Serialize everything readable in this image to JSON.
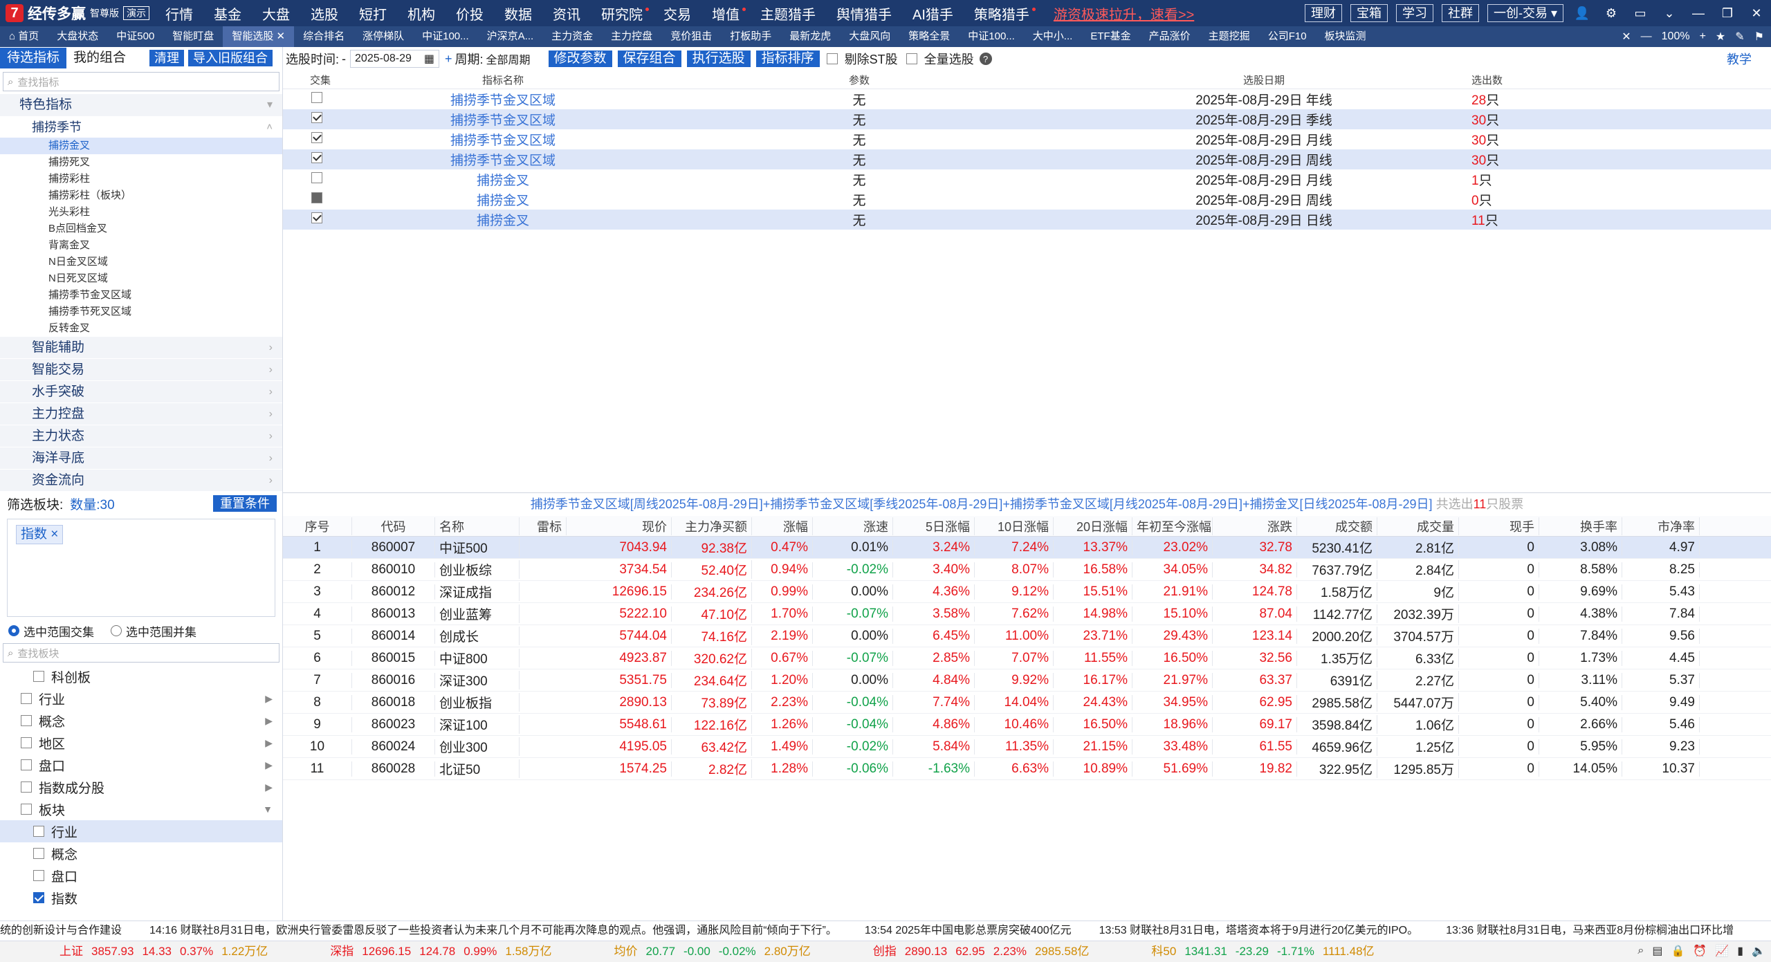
{
  "app": {
    "name": "经传多赢",
    "edition": "智尊版",
    "demo": "演示"
  },
  "menu": [
    {
      "label": "行情",
      "dot": false
    },
    {
      "label": "基金",
      "dot": false
    },
    {
      "label": "大盘",
      "dot": false
    },
    {
      "label": "选股",
      "dot": false
    },
    {
      "label": "短打",
      "dot": false
    },
    {
      "label": "机构",
      "dot": false
    },
    {
      "label": "价投",
      "dot": false
    },
    {
      "label": "数据",
      "dot": false
    },
    {
      "label": "资讯",
      "dot": false
    },
    {
      "label": "研究院",
      "dot": true
    },
    {
      "label": "交易",
      "dot": false
    },
    {
      "label": "增值",
      "dot": true
    },
    {
      "label": "主题猎手",
      "dot": false
    },
    {
      "label": "舆情猎手",
      "dot": false
    },
    {
      "label": "AI猎手",
      "dot": false
    },
    {
      "label": "策略猎手",
      "dot": true
    }
  ],
  "promo": "游资极速拉升，速看>>",
  "top_buttons": [
    "理财",
    "宝箱",
    "学习",
    "社群",
    "一创-交易"
  ],
  "tabs": [
    "首页",
    "大盘状态",
    "中证500",
    "智能盯盘",
    "智能选股",
    "综合排名",
    "涨停梯队",
    "中证100...",
    "沪深京A...",
    "主力资金",
    "主力控盘",
    "竞价狙击",
    "打板助手",
    "最新龙虎",
    "大盘风向",
    "策略全景",
    "中证100...",
    "大中小...",
    "ETF基金",
    "产品涨价",
    "主题挖掘",
    "公司F10",
    "板块监测"
  ],
  "zoom": "100%",
  "left": {
    "tab_pending": "待选指标",
    "tab_mine": "我的组合",
    "btn_clear": "清理",
    "btn_import": "导入旧版组合",
    "search_placeholder": "查找指标",
    "group_special": "特色指标",
    "sub_season": "捕捞季节",
    "items": [
      "捕捞金叉",
      "捕捞死叉",
      "捕捞彩柱",
      "捕捞彩柱（板块）",
      "光头彩柱",
      "B点回档金叉",
      "背离金叉",
      "N日金叉区域",
      "N日死叉区域",
      "捕捞季节金叉区域",
      "捕捞季节死叉区域",
      "反转金叉"
    ],
    "groups": [
      "智能辅助",
      "智能交易",
      "水手突破",
      "主力控盘",
      "主力状态",
      "海洋寻底",
      "资金流向"
    ],
    "filter_label": "筛选板块:",
    "filter_count": "数量:30",
    "reset": "重置条件",
    "tag": "指数",
    "radio_and": "选中范围交集",
    "radio_or": "选中范围并集",
    "board_search": "查找板块",
    "boards_top": [
      "科创板"
    ],
    "board_groups": [
      "行业",
      "概念",
      "地区",
      "盘口",
      "指数成分股",
      "板块"
    ],
    "board_sub": [
      "行业",
      "概念",
      "盘口",
      "指数"
    ]
  },
  "toolbar": {
    "label_time": "选股时间:",
    "date": "2025-08-29",
    "plus": "+",
    "label_period": "周期:",
    "period": "全部周期",
    "btn_edit": "修改参数",
    "btn_save": "保存组合",
    "btn_run": "执行选股",
    "btn_sort": "指标排序",
    "cb_st": "剔除ST股",
    "cb_all": "全量选股",
    "help": "教学"
  },
  "top_table": {
    "headers": [
      "交集",
      "指标名称",
      "参数",
      "选股日期",
      "选出数"
    ],
    "rows": [
      {
        "name": "捕捞季节金叉区域",
        "param": "无",
        "date": "2025年-08月-29日 年线",
        "count": "28",
        "unit": "只",
        "checked": false,
        "hl": false,
        "indent": false
      },
      {
        "name": "捕捞季节金叉区域",
        "param": "无",
        "date": "2025年-08月-29日 季线",
        "count": "30",
        "unit": "只",
        "checked": true,
        "hl": true,
        "indent": false
      },
      {
        "name": "捕捞季节金叉区域",
        "param": "无",
        "date": "2025年-08月-29日 月线",
        "count": "30",
        "unit": "只",
        "checked": true,
        "hl": false,
        "indent": false
      },
      {
        "name": "捕捞季节金叉区域",
        "param": "无",
        "date": "2025年-08月-29日 周线",
        "count": "30",
        "unit": "只",
        "checked": true,
        "hl": true,
        "indent": false
      },
      {
        "name": "捕捞金叉",
        "param": "无",
        "date": "2025年-08月-29日 月线",
        "count": "1",
        "unit": "只",
        "checked": false,
        "hl": false,
        "indent": true
      },
      {
        "name": "捕捞金叉",
        "param": "无",
        "date": "2025年-08月-29日 周线",
        "count": "0",
        "unit": "只",
        "checked": false,
        "hl": false,
        "indent": true
      },
      {
        "name": "捕捞金叉",
        "param": "无",
        "date": "2025年-08月-29日 日线",
        "count": "11",
        "unit": "只",
        "checked": true,
        "hl": true,
        "indent": true
      }
    ]
  },
  "result_title": {
    "text": "捕捞季节金叉区域[周线2025年-08月-29日]+捕捞季节金叉区域[季线2025年-08月-29日]+捕捞季节金叉区域[月线2025年-08月-29日]+捕捞金叉[日线2025年-08月-29日]",
    "pre": "共选出",
    "count": "11",
    "post": "只股票"
  },
  "result_table": {
    "headers": [
      "序号",
      "代码",
      "名称",
      "雷标",
      "现价",
      "主力净买额",
      "涨幅",
      "涨速",
      "5日涨幅",
      "10日涨幅",
      "20日涨幅",
      "年初至今涨幅",
      "涨跌",
      "成交额",
      "成交量",
      "现手",
      "换手率",
      "市净率"
    ],
    "rows": [
      [
        "1",
        "860007",
        "中证500",
        "",
        "7043.94",
        "92.38亿",
        "0.47%",
        "0.01%",
        "3.24%",
        "7.24%",
        "13.37%",
        "23.02%",
        "32.78",
        "5230.41亿",
        "2.81亿",
        "0",
        "3.08%",
        "4.97"
      ],
      [
        "2",
        "860010",
        "创业板综",
        "",
        "3734.54",
        "52.40亿",
        "0.94%",
        "-0.02%",
        "3.40%",
        "8.07%",
        "16.58%",
        "34.05%",
        "34.82",
        "7637.79亿",
        "2.84亿",
        "0",
        "8.58%",
        "8.25"
      ],
      [
        "3",
        "860012",
        "深证成指",
        "",
        "12696.15",
        "234.26亿",
        "0.99%",
        "0.00%",
        "4.36%",
        "9.12%",
        "15.51%",
        "21.91%",
        "124.78",
        "1.58万亿",
        "9亿",
        "0",
        "9.69%",
        "5.43"
      ],
      [
        "4",
        "860013",
        "创业蓝筹",
        "",
        "5222.10",
        "47.10亿",
        "1.70%",
        "-0.07%",
        "3.58%",
        "7.62%",
        "14.98%",
        "15.10%",
        "87.04",
        "1142.77亿",
        "2032.39万",
        "0",
        "4.38%",
        "7.84"
      ],
      [
        "5",
        "860014",
        "创成长",
        "",
        "5744.04",
        "74.16亿",
        "2.19%",
        "0.00%",
        "6.45%",
        "11.00%",
        "23.71%",
        "29.43%",
        "123.14",
        "2000.20亿",
        "3704.57万",
        "0",
        "7.84%",
        "9.56"
      ],
      [
        "6",
        "860015",
        "中证800",
        "",
        "4923.87",
        "320.62亿",
        "0.67%",
        "-0.07%",
        "2.85%",
        "7.07%",
        "11.55%",
        "16.50%",
        "32.56",
        "1.35万亿",
        "6.33亿",
        "0",
        "1.73%",
        "4.45"
      ],
      [
        "7",
        "860016",
        "深证300",
        "",
        "5351.75",
        "234.64亿",
        "1.20%",
        "0.00%",
        "4.84%",
        "9.92%",
        "16.17%",
        "21.97%",
        "63.37",
        "6391亿",
        "2.27亿",
        "0",
        "3.11%",
        "5.37"
      ],
      [
        "8",
        "860018",
        "创业板指",
        "",
        "2890.13",
        "73.89亿",
        "2.23%",
        "-0.04%",
        "7.74%",
        "14.04%",
        "24.43%",
        "34.95%",
        "62.95",
        "2985.58亿",
        "5447.07万",
        "0",
        "5.40%",
        "9.49"
      ],
      [
        "9",
        "860023",
        "深证100",
        "",
        "5548.61",
        "122.16亿",
        "1.26%",
        "-0.04%",
        "4.86%",
        "10.46%",
        "16.50%",
        "18.96%",
        "69.17",
        "3598.84亿",
        "1.06亿",
        "0",
        "2.66%",
        "5.46"
      ],
      [
        "10",
        "860024",
        "创业300",
        "",
        "4195.05",
        "63.42亿",
        "1.49%",
        "-0.02%",
        "5.84%",
        "11.35%",
        "21.15%",
        "33.48%",
        "61.55",
        "4659.96亿",
        "1.25亿",
        "0",
        "5.95%",
        "9.23"
      ],
      [
        "11",
        "860028",
        "北证50",
        "",
        "1574.25",
        "2.82亿",
        "1.28%",
        "-0.06%",
        "-1.63%",
        "6.63%",
        "10.89%",
        "51.69%",
        "19.82",
        "322.95亿",
        "1295.85万",
        "0",
        "14.05%",
        "10.37"
      ]
    ]
  },
  "news": [
    "统的创新设计与合作建设",
    "14:16 财联社8月31日电，欧洲央行管委雷恩反驳了一些投资者认为未来几个月不可能再次降息的观点。他强调，通胀风险目前“倾向于下行”。",
    "13:54 2025年中国电影总票房突破400亿元",
    "13:53 财联社8月31日电，塔塔资本将于9月进行20亿美元的IPO。",
    "13:36 财联社8月31日电，马来西亚8月份棕榈油出口环比增"
  ],
  "indices": [
    {
      "name": "上证",
      "val": "3857.93",
      "chg": "14.33",
      "pct": "0.37%",
      "amt": "1.22万亿",
      "dir": "up"
    },
    {
      "name": "深指",
      "val": "12696.15",
      "chg": "124.78",
      "pct": "0.99%",
      "amt": "1.58万亿",
      "dir": "up"
    },
    {
      "name": "均价",
      "val": "20.77",
      "chg": "-0.00",
      "pct": "-0.02%",
      "amt": "2.80万亿",
      "dir": "down"
    },
    {
      "name": "创指",
      "val": "2890.13",
      "chg": "62.95",
      "pct": "2.23%",
      "amt": "2985.58亿",
      "dir": "up"
    },
    {
      "name": "科50",
      "val": "1341.31",
      "chg": "-23.29",
      "pct": "-1.71%",
      "amt": "1111.48亿",
      "dir": "down"
    }
  ],
  "colors": {
    "accent": "#1e63c9",
    "up": "#e8181e",
    "down": "#11a24a",
    "topbar": "#1d3a6e"
  }
}
